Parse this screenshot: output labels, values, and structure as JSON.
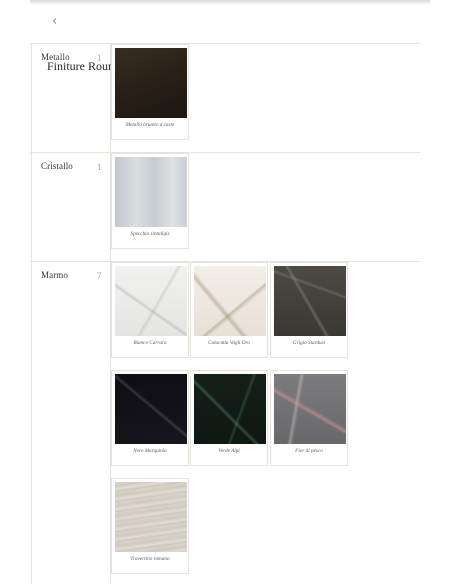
{
  "nav": {
    "back_icon": "‹"
  },
  "overlay_title": "Finiture Round",
  "categories": [
    {
      "name": "Metallo",
      "count": "1",
      "items": [
        {
          "label": "Metallo brunito a caste"
        }
      ]
    },
    {
      "name": "Cristallo",
      "count": "1",
      "items": [
        {
          "label": "Specchio sintaligis"
        }
      ]
    },
    {
      "name": "Marmo",
      "count": "7",
      "items": [
        {
          "label": "Bianco Carrara"
        },
        {
          "label": "Calacatta Vagli Oro"
        },
        {
          "label": "Grigio Stardust"
        },
        {
          "label": "Nero Marquinia"
        },
        {
          "label": "Verde Alpi"
        },
        {
          "label": "Fior di pesco"
        },
        {
          "label": "Travertino romano"
        }
      ]
    }
  ]
}
